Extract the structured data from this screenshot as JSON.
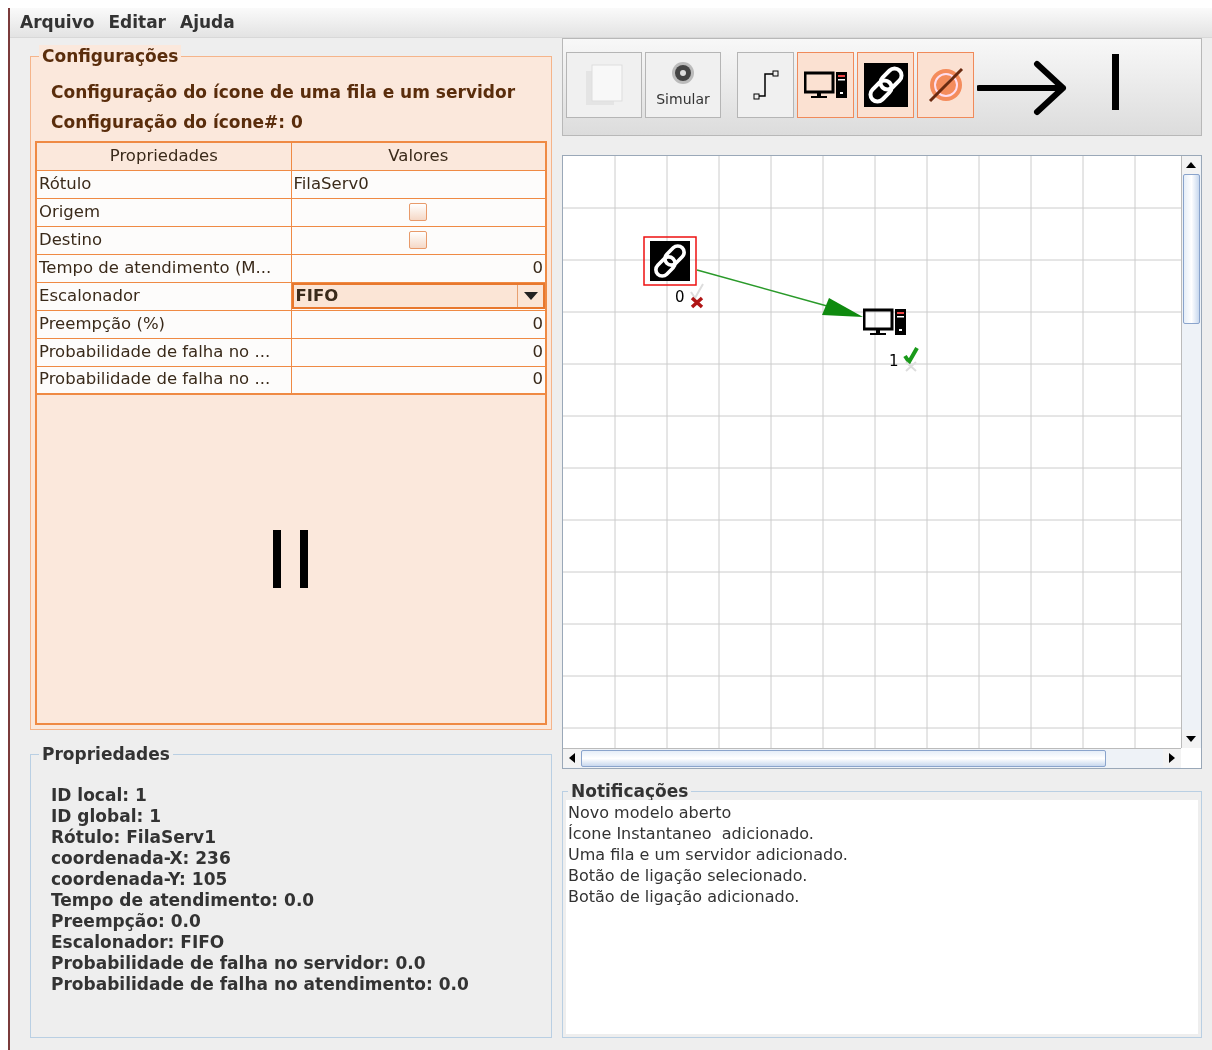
{
  "menu": [
    {
      "label": "Arquivo"
    },
    {
      "label": "Editar"
    },
    {
      "label": "Ajuda"
    }
  ],
  "config": {
    "title": "Configurações",
    "heading": "Configuração do ícone de uma fila e um servidor",
    "subheading": "Configuração do ícone#: 0",
    "table": {
      "columns": [
        "Propriedades",
        "Valores"
      ],
      "rows": [
        {
          "kind": "text",
          "label": "Rótulo",
          "value": "FilaServ0"
        },
        {
          "kind": "checkbox",
          "label": "Origem",
          "checked": false
        },
        {
          "kind": "checkbox",
          "label": "Destino",
          "checked": false
        },
        {
          "kind": "number",
          "label": "Tempo de atendimento (M...",
          "value": "0"
        },
        {
          "kind": "select",
          "label": "Escalonador",
          "value": "FIFO"
        },
        {
          "kind": "number",
          "label": "Preempção (%)",
          "value": "0"
        },
        {
          "kind": "number",
          "label": "Probabilidade de falha no ...",
          "value": "0"
        },
        {
          "kind": "number",
          "label": "Probabilidade de falha no ...",
          "value": "0"
        }
      ]
    }
  },
  "toolbar": {
    "buttons": [
      {
        "kind": "blank",
        "selected": false
      },
      {
        "kind": "simulate",
        "label": "Simular",
        "selected": false
      },
      {
        "kind": "route",
        "selected": false
      },
      {
        "kind": "server",
        "selected": true
      },
      {
        "kind": "link",
        "selected": true
      },
      {
        "kind": "gauge",
        "selected": true
      }
    ]
  },
  "canvas": {
    "nodes": [
      {
        "kind": "link",
        "label": "0",
        "selected": true,
        "valid": false
      },
      {
        "kind": "server",
        "label": "1",
        "selected": false,
        "valid": true
      }
    ]
  },
  "properties": {
    "title": "Propriedades",
    "lines": [
      "ID local: 1",
      "ID global: 1",
      "Rótulo: FilaServ1",
      "coordenada-X: 236",
      "coordenada-Y: 105",
      "Tempo de atendimento: 0.0",
      "Preempção: 0.0",
      "Escalonador: FIFO",
      "Probabilidade de falha no servidor: 0.0",
      "Probabilidade de falha no atendimento: 0.0"
    ]
  },
  "notifications": {
    "title": "Notificações",
    "lines": [
      "Novo modelo aberto",
      "Ícone Instantaneo  adicionado.",
      "Uma fila e um servidor adicionado.",
      "Botão de ligação selecionado.",
      "Botão de ligação adicionado."
    ]
  }
}
